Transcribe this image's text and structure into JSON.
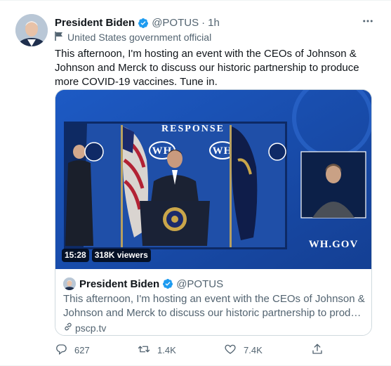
{
  "tweet": {
    "author_name": "President Biden",
    "handle": "@POTUS",
    "separator": "·",
    "time": "1h",
    "label": "United States government official",
    "text": "This afternoon, I'm hosting an event with the CEOs of Johnson & Johnson and Merck to discuss our historic partnership to produce more COVID-19 vaccines. Tune in.",
    "more_icon": "more-icon"
  },
  "media": {
    "backdrop_text": "RESPONSE",
    "wh_logo_text": "WH",
    "watermark": "WH.GOV",
    "duration": "15:28",
    "viewers": "318K viewers"
  },
  "quote": {
    "author_name": "President Biden",
    "handle": "@POTUS",
    "text_line1": "This afternoon, I'm hosting an event with the CEOs of Johnson &",
    "text_line2": "Johnson and Merck to discuss our historic partnership to produce mor...",
    "link": "pscp.tv"
  },
  "actions": {
    "replies": "627",
    "retweets": "1.4K",
    "likes": "7.4K"
  },
  "colors": {
    "verified": "#1d9bf0",
    "muted": "#536471",
    "media_blue": "#1a4fb0"
  }
}
